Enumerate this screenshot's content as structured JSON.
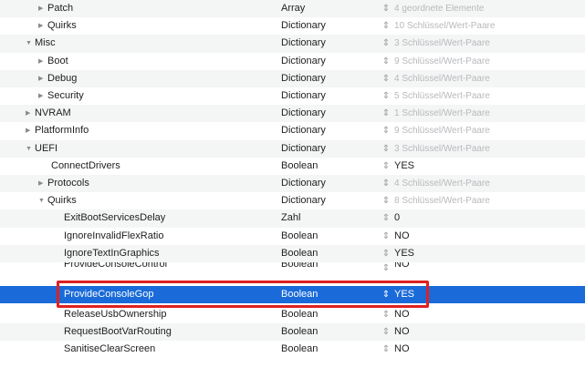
{
  "rows": [
    {
      "key": "Patch",
      "disclosure": "collapsed",
      "type": "Array",
      "value": "4 geordnete Elemente",
      "value_style": "muted"
    },
    {
      "key": "Quirks",
      "disclosure": "collapsed",
      "type": "Dictionary",
      "value": "10 Schlüssel/Wert-Paare",
      "value_style": "muted"
    },
    {
      "key": "Misc",
      "disclosure": "expanded",
      "type": "Dictionary",
      "value": "3 Schlüssel/Wert-Paare",
      "value_style": "muted"
    },
    {
      "key": "Boot",
      "disclosure": "collapsed",
      "type": "Dictionary",
      "value": "9 Schlüssel/Wert-Paare",
      "value_style": "muted"
    },
    {
      "key": "Debug",
      "disclosure": "collapsed",
      "type": "Dictionary",
      "value": "4 Schlüssel/Wert-Paare",
      "value_style": "muted"
    },
    {
      "key": "Security",
      "disclosure": "collapsed",
      "type": "Dictionary",
      "value": "5 Schlüssel/Wert-Paare",
      "value_style": "muted"
    },
    {
      "key": "NVRAM",
      "disclosure": "collapsed",
      "type": "Dictionary",
      "value": "1 Schlüssel/Wert-Paare",
      "value_style": "muted"
    },
    {
      "key": "PlatformInfo",
      "disclosure": "collapsed",
      "type": "Dictionary",
      "value": "9 Schlüssel/Wert-Paare",
      "value_style": "muted"
    },
    {
      "key": "UEFI",
      "disclosure": "expanded",
      "type": "Dictionary",
      "value": "3 Schlüssel/Wert-Paare",
      "value_style": "muted"
    },
    {
      "key": "ConnectDrivers",
      "disclosure": "none",
      "type": "Boolean",
      "value": "YES",
      "value_style": "strong"
    },
    {
      "key": "Protocols",
      "disclosure": "collapsed",
      "type": "Dictionary",
      "value": "4 Schlüssel/Wert-Paare",
      "value_style": "muted"
    },
    {
      "key": "Quirks",
      "disclosure": "expanded",
      "type": "Dictionary",
      "value": "8 Schlüssel/Wert-Paare",
      "value_style": "muted"
    },
    {
      "key": "ExitBootServicesDelay",
      "disclosure": "none",
      "type": "Zahl",
      "value": "0",
      "value_style": "strong"
    },
    {
      "key": "IgnoreInvalidFlexRatio",
      "disclosure": "none",
      "type": "Boolean",
      "value": "NO",
      "value_style": "strong"
    },
    {
      "key": "IgnoreTextInGraphics",
      "disclosure": "none",
      "type": "Boolean",
      "value": "YES",
      "value_style": "strong"
    },
    {
      "key": "ProvideConsoleControl",
      "disclosure": "none",
      "type": "Boolean",
      "value": "NO",
      "value_style": "strong"
    },
    {
      "key": "ProvideConsoleGop",
      "disclosure": "none",
      "type": "Boolean",
      "value": "YES",
      "value_style": "strong",
      "selected": true
    },
    {
      "key": "ReleaseUsbOwnership",
      "disclosure": "none",
      "type": "Boolean",
      "value": "NO",
      "value_style": "strong"
    },
    {
      "key": "RequestBootVarRouting",
      "disclosure": "none",
      "type": "Boolean",
      "value": "NO",
      "value_style": "strong"
    },
    {
      "key": "SanitiseClearScreen",
      "disclosure": "none",
      "type": "Boolean",
      "value": "NO",
      "value_style": "strong"
    }
  ],
  "icons": {
    "collapsed": "disclosure-collapsed-icon",
    "expanded": "disclosure-expanded-icon",
    "stepper": "value-stepper-icon"
  },
  "colors": {
    "selection": "#1a6bd9",
    "annotation": "#e02020",
    "stripe": "#f4f5f5",
    "muted_text": "#b7b9bc"
  }
}
